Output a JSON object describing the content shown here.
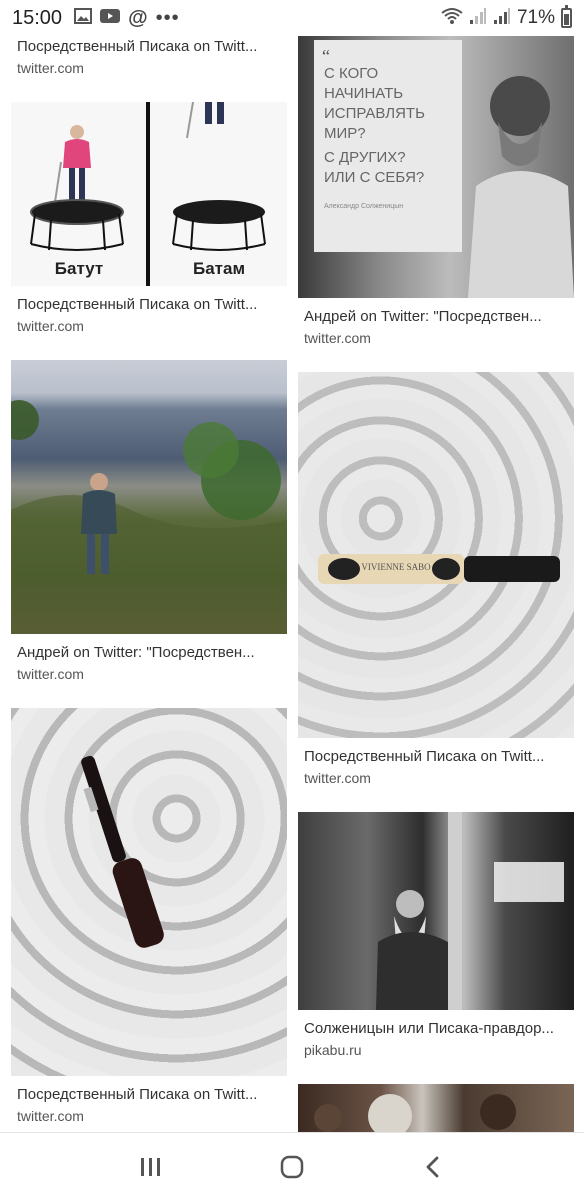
{
  "status_bar": {
    "time": "15:00",
    "left_icons": [
      "gallery-icon",
      "youtube-icon",
      "at-icon",
      "more-dots-icon"
    ],
    "battery_percent": "71%",
    "right_icons": [
      "wifi-icon",
      "signal-1-icon",
      "signal-2-icon",
      "battery-icon"
    ]
  },
  "results": {
    "left": [
      {
        "caption": "Посредственный Писака on Twitt...",
        "source": "twitter.com",
        "image": "none"
      },
      {
        "caption": "Посредственный Писака on Twitt...",
        "source": "twitter.com",
        "image": "trampoline-comparison",
        "image_text": [
          "Батут",
          "Батам"
        ]
      },
      {
        "caption": "Андрей on Twitter: \"Посредствен...",
        "source": "twitter.com",
        "image": "man-on-lakeshore"
      },
      {
        "caption": "Посредственный Писака on Twitt...",
        "source": "twitter.com",
        "image": "mascara-on-fabric"
      }
    ],
    "right": [
      {
        "caption": "Андрей on Twitter: \"Посредствен...",
        "source": "twitter.com",
        "image": "solzhenitsyn-quote",
        "image_text": [
          "С КОГО",
          "НАЧИНАТЬ",
          "ИСПРАВЛЯТЬ",
          "МИР?",
          "С ДРУГИХ?",
          "ИЛИ С СЕБЯ?",
          "Александр Солженицын"
        ]
      },
      {
        "caption": "Посредственный Писака on Twitt...",
        "source": "twitter.com",
        "image": "vivienne-sabo-concealer",
        "image_text": [
          "VIVIENNE SABO"
        ]
      },
      {
        "caption": "Солженицын или Писака-правдор...",
        "source": "pikabu.ru",
        "image": "man-in-train-door"
      },
      {
        "caption": "",
        "source": "",
        "image": "crowd-partial"
      }
    ]
  },
  "nav_bar": {
    "buttons": [
      "recent-apps-icon",
      "home-icon",
      "back-icon"
    ]
  }
}
